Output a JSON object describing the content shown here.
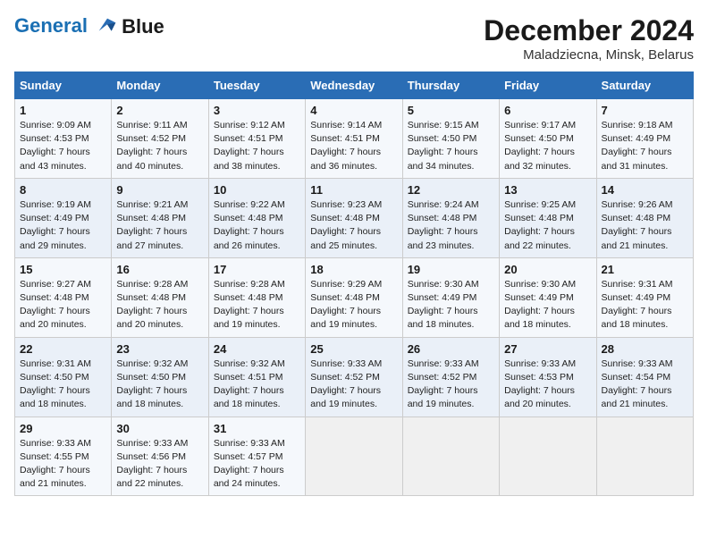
{
  "logo": {
    "line1": "General",
    "line2": "Blue"
  },
  "title": "December 2024",
  "subtitle": "Maladziecna, Minsk, Belarus",
  "weekdays": [
    "Sunday",
    "Monday",
    "Tuesday",
    "Wednesday",
    "Thursday",
    "Friday",
    "Saturday"
  ],
  "weeks": [
    [
      {
        "day": "1",
        "sunrise": "9:09 AM",
        "sunset": "4:53 PM",
        "daylight": "7 hours and 43 minutes."
      },
      {
        "day": "2",
        "sunrise": "9:11 AM",
        "sunset": "4:52 PM",
        "daylight": "7 hours and 40 minutes."
      },
      {
        "day": "3",
        "sunrise": "9:12 AM",
        "sunset": "4:51 PM",
        "daylight": "7 hours and 38 minutes."
      },
      {
        "day": "4",
        "sunrise": "9:14 AM",
        "sunset": "4:51 PM",
        "daylight": "7 hours and 36 minutes."
      },
      {
        "day": "5",
        "sunrise": "9:15 AM",
        "sunset": "4:50 PM",
        "daylight": "7 hours and 34 minutes."
      },
      {
        "day": "6",
        "sunrise": "9:17 AM",
        "sunset": "4:50 PM",
        "daylight": "7 hours and 32 minutes."
      },
      {
        "day": "7",
        "sunrise": "9:18 AM",
        "sunset": "4:49 PM",
        "daylight": "7 hours and 31 minutes."
      }
    ],
    [
      {
        "day": "8",
        "sunrise": "9:19 AM",
        "sunset": "4:49 PM",
        "daylight": "7 hours and 29 minutes."
      },
      {
        "day": "9",
        "sunrise": "9:21 AM",
        "sunset": "4:48 PM",
        "daylight": "7 hours and 27 minutes."
      },
      {
        "day": "10",
        "sunrise": "9:22 AM",
        "sunset": "4:48 PM",
        "daylight": "7 hours and 26 minutes."
      },
      {
        "day": "11",
        "sunrise": "9:23 AM",
        "sunset": "4:48 PM",
        "daylight": "7 hours and 25 minutes."
      },
      {
        "day": "12",
        "sunrise": "9:24 AM",
        "sunset": "4:48 PM",
        "daylight": "7 hours and 23 minutes."
      },
      {
        "day": "13",
        "sunrise": "9:25 AM",
        "sunset": "4:48 PM",
        "daylight": "7 hours and 22 minutes."
      },
      {
        "day": "14",
        "sunrise": "9:26 AM",
        "sunset": "4:48 PM",
        "daylight": "7 hours and 21 minutes."
      }
    ],
    [
      {
        "day": "15",
        "sunrise": "9:27 AM",
        "sunset": "4:48 PM",
        "daylight": "7 hours and 20 minutes."
      },
      {
        "day": "16",
        "sunrise": "9:28 AM",
        "sunset": "4:48 PM",
        "daylight": "7 hours and 20 minutes."
      },
      {
        "day": "17",
        "sunrise": "9:28 AM",
        "sunset": "4:48 PM",
        "daylight": "7 hours and 19 minutes."
      },
      {
        "day": "18",
        "sunrise": "9:29 AM",
        "sunset": "4:48 PM",
        "daylight": "7 hours and 19 minutes."
      },
      {
        "day": "19",
        "sunrise": "9:30 AM",
        "sunset": "4:49 PM",
        "daylight": "7 hours and 18 minutes."
      },
      {
        "day": "20",
        "sunrise": "9:30 AM",
        "sunset": "4:49 PM",
        "daylight": "7 hours and 18 minutes."
      },
      {
        "day": "21",
        "sunrise": "9:31 AM",
        "sunset": "4:49 PM",
        "daylight": "7 hours and 18 minutes."
      }
    ],
    [
      {
        "day": "22",
        "sunrise": "9:31 AM",
        "sunset": "4:50 PM",
        "daylight": "7 hours and 18 minutes."
      },
      {
        "day": "23",
        "sunrise": "9:32 AM",
        "sunset": "4:50 PM",
        "daylight": "7 hours and 18 minutes."
      },
      {
        "day": "24",
        "sunrise": "9:32 AM",
        "sunset": "4:51 PM",
        "daylight": "7 hours and 18 minutes."
      },
      {
        "day": "25",
        "sunrise": "9:33 AM",
        "sunset": "4:52 PM",
        "daylight": "7 hours and 19 minutes."
      },
      {
        "day": "26",
        "sunrise": "9:33 AM",
        "sunset": "4:52 PM",
        "daylight": "7 hours and 19 minutes."
      },
      {
        "day": "27",
        "sunrise": "9:33 AM",
        "sunset": "4:53 PM",
        "daylight": "7 hours and 20 minutes."
      },
      {
        "day": "28",
        "sunrise": "9:33 AM",
        "sunset": "4:54 PM",
        "daylight": "7 hours and 21 minutes."
      }
    ],
    [
      {
        "day": "29",
        "sunrise": "9:33 AM",
        "sunset": "4:55 PM",
        "daylight": "7 hours and 21 minutes."
      },
      {
        "day": "30",
        "sunrise": "9:33 AM",
        "sunset": "4:56 PM",
        "daylight": "7 hours and 22 minutes."
      },
      {
        "day": "31",
        "sunrise": "9:33 AM",
        "sunset": "4:57 PM",
        "daylight": "7 hours and 24 minutes."
      },
      null,
      null,
      null,
      null
    ]
  ],
  "labels": {
    "sunrise": "Sunrise:",
    "sunset": "Sunset:",
    "daylight": "Daylight:"
  }
}
